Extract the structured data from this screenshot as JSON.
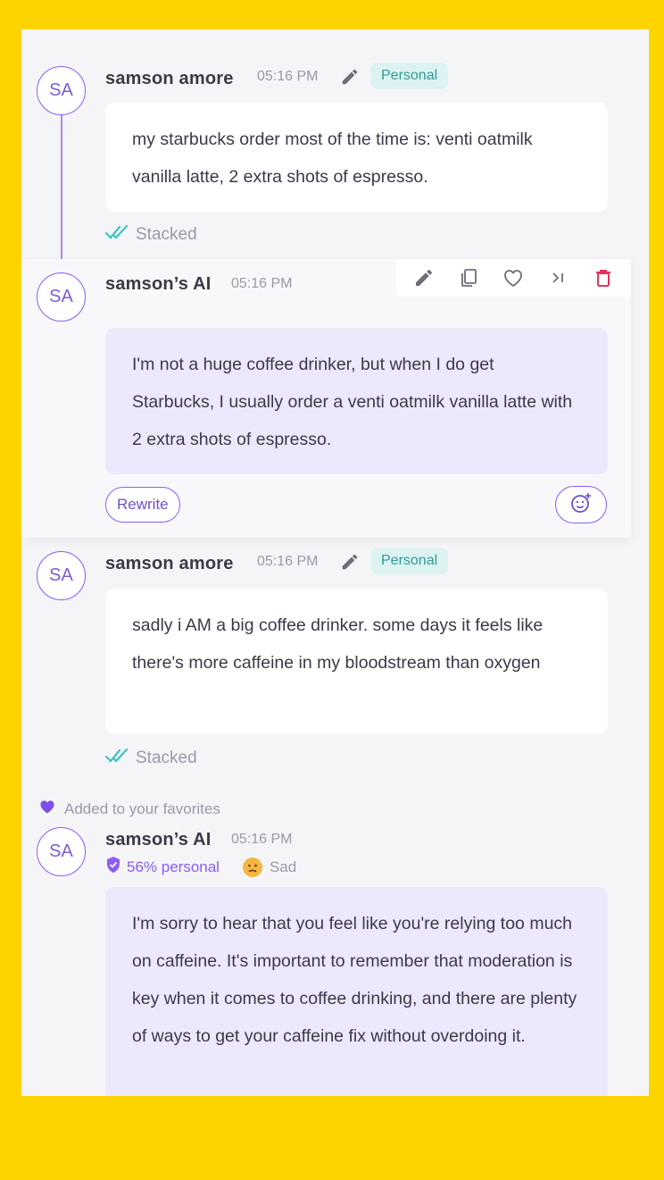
{
  "messages": [
    {
      "avatar": "SA",
      "author": "samson amore",
      "time": "05:16 PM",
      "tag": "Personal",
      "text": "my starbucks order most of the time is: venti oatmilk vanilla latte, 2 extra shots of espresso.",
      "status": "Stacked"
    },
    {
      "avatar": "SA",
      "author": "samson’s AI",
      "time": "05:16 PM",
      "text": "I'm not a huge coffee drinker, but when I do get Starbucks, I usually order a venti oatmilk vanilla latte with 2 extra shots of espresso.",
      "rewrite_label": "Rewrite"
    },
    {
      "avatar": "SA",
      "author": "samson amore",
      "time": "05:16 PM",
      "tag": "Personal",
      "text": "sadly i AM a big coffee drinker. some days it feels like there's more caffeine in my bloodstream than oxygen",
      "status": "Stacked"
    },
    {
      "favorite_note": "Added to your favorites",
      "avatar": "SA",
      "author": "samson’s AI",
      "time": "05:16 PM",
      "personal_pct": "56% personal",
      "mood": "Sad",
      "text": "I'm sorry to hear that you feel like you're relying too much on caffeine. It's important to remember that moderation is key when it comes to coffee drinking, and there are plenty of ways to get your caffeine fix without overdoing it."
    }
  ],
  "toolbar_icons": [
    "pencil-icon",
    "copy-icon",
    "heart-icon",
    "skip-icon",
    "trash-icon"
  ],
  "colors": {
    "background": "#FDD400",
    "panel": "#F5F5F8",
    "accent": "#8B5CF6",
    "tag_bg": "#DDF3F2",
    "tag_text": "#2E9A96",
    "ai_bubble": "#EDE8FC",
    "delete": "#E5335A"
  }
}
